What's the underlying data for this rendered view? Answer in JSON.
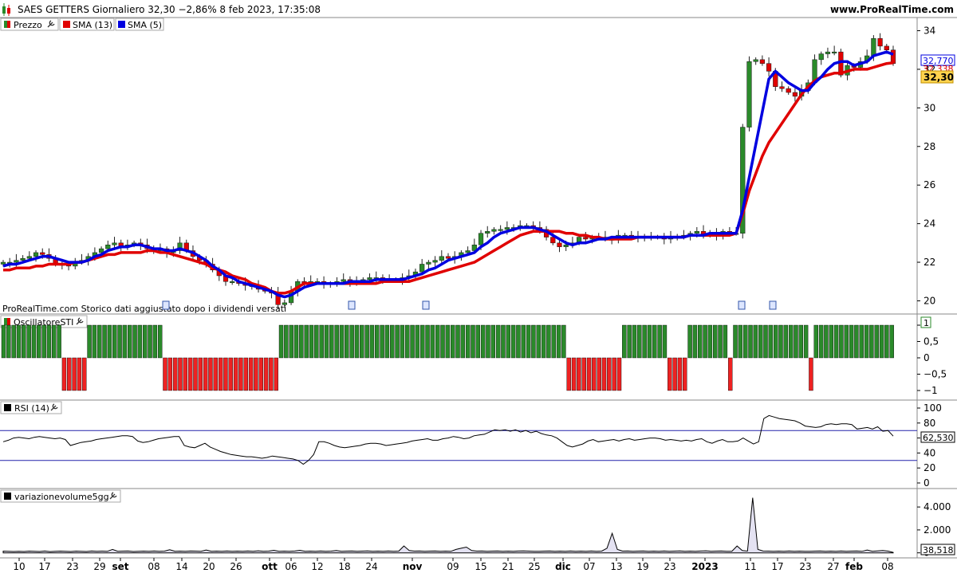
{
  "header": {
    "title": "SAES GETTERS Giornaliero 32,30 −2,86% 8 feb 2023, 17:35:08",
    "site": "www.ProRealTime.com"
  },
  "panels": {
    "price": {
      "legend": [
        {
          "label": "Prezzo",
          "color": "#2a8a2a"
        },
        {
          "label": "SMA (13)",
          "color": "#e00000"
        },
        {
          "label": "SMA (5)",
          "color": "#0000e0"
        }
      ],
      "note": "ProRealTime.com  Storico dati aggiustato dopo i dividendi versati",
      "sma5_badge": "32,770",
      "sma13_badge": "32,338",
      "price_badge": "32,30"
    },
    "osc": {
      "legend": "OscillatoreSTI",
      "badge": "1"
    },
    "rsi": {
      "legend": "RSI (14)",
      "badge": "62,530"
    },
    "vol": {
      "legend": "variazionevolume5gg",
      "badge": "38,518"
    }
  },
  "chart_data": [
    {
      "type": "candlestick",
      "panel": "price",
      "y_ticks": [
        "34",
        "32",
        "30",
        "28",
        "26",
        "24",
        "22",
        "20"
      ],
      "ylim": [
        19.4,
        34.6
      ],
      "x_labels": [
        "10",
        "17",
        "23",
        "29",
        "set",
        "08",
        "14",
        "20",
        "26",
        "ott",
        "06",
        "12",
        "18",
        "24",
        "nov",
        "09",
        "15",
        "21",
        "25",
        "dic",
        "07",
        "13",
        "19",
        "23",
        "2023",
        "11",
        "17",
        "23",
        "27",
        "feb",
        "08"
      ],
      "x_label_bold": [
        "set",
        "ott",
        "nov",
        "dic",
        "2023",
        "feb"
      ],
      "series": [
        {
          "name": "Prezzo",
          "values": [
            22.0,
            22.0,
            22.1,
            22.2,
            22.3,
            22.5,
            22.4,
            22.2,
            21.9,
            21.9,
            21.8,
            22.0,
            22.1,
            22.3,
            22.5,
            22.7,
            22.9,
            23.0,
            22.8,
            22.9,
            23.0,
            22.9,
            22.7,
            22.6,
            22.7,
            22.5,
            22.6,
            23.0,
            22.6,
            22.3,
            22.1,
            21.9,
            21.6,
            21.3,
            21.0,
            21.0,
            20.9,
            20.8,
            20.8,
            20.6,
            20.5,
            20.4,
            19.8,
            19.9,
            20.5,
            21.0,
            20.9,
            21.0,
            21.0,
            20.9,
            20.9,
            21.0,
            21.1,
            21.0,
            21.0,
            21.1,
            21.2,
            21.2,
            21.1,
            21.1,
            21.1,
            21.2,
            21.3,
            21.5,
            21.9,
            22.0,
            22.1,
            22.3,
            22.2,
            22.3,
            22.5,
            22.6,
            22.9,
            23.5,
            23.6,
            23.7,
            23.7,
            23.8,
            23.8,
            23.9,
            23.9,
            23.8,
            23.7,
            23.3,
            23.0,
            22.8,
            22.9,
            23.0,
            23.3,
            23.2,
            23.3,
            23.3,
            23.2,
            23.2,
            23.4,
            23.4,
            23.3,
            23.3,
            23.3,
            23.3,
            23.3,
            23.2,
            23.3,
            23.3,
            23.4,
            23.5,
            23.6,
            23.4,
            23.5,
            23.4,
            23.6,
            23.5,
            23.5,
            29.0,
            32.4,
            32.5,
            32.3,
            31.9,
            31.1,
            31.0,
            30.8,
            30.6,
            30.9,
            31.3,
            32.5,
            32.8,
            32.9,
            32.9,
            31.7,
            32.2,
            32.1,
            32.4,
            32.7,
            33.6,
            33.2,
            33.0,
            32.3
          ]
        },
        {
          "name": "SMA (13)",
          "values": [
            21.6,
            21.6,
            21.7,
            21.7,
            21.7,
            21.8,
            21.8,
            21.9,
            21.9,
            21.9,
            21.9,
            22.0,
            22.0,
            22.1,
            22.2,
            22.3,
            22.4,
            22.4,
            22.5,
            22.5,
            22.5,
            22.5,
            22.6,
            22.6,
            22.5,
            22.5,
            22.4,
            22.3,
            22.2,
            22.1,
            22.0,
            21.9,
            21.7,
            21.6,
            21.5,
            21.3,
            21.2,
            21.1,
            20.9,
            20.8,
            20.7,
            20.5,
            20.4,
            20.4,
            20.5,
            20.7,
            20.9,
            20.9,
            20.9,
            20.9,
            20.9,
            20.9,
            20.9,
            20.9,
            20.9,
            20.9,
            20.9,
            20.9,
            21.0,
            21.0,
            21.0,
            21.0,
            21.0,
            21.1,
            21.2,
            21.3,
            21.4,
            21.5,
            21.6,
            21.7,
            21.8,
            21.9,
            22.0,
            22.2,
            22.4,
            22.6,
            22.8,
            23.0,
            23.2,
            23.4,
            23.5,
            23.6,
            23.6,
            23.6,
            23.6,
            23.6,
            23.5,
            23.5,
            23.4,
            23.4,
            23.3,
            23.3,
            23.2,
            23.2,
            23.2,
            23.2,
            23.2,
            23.3,
            23.3,
            23.3,
            23.3,
            23.3,
            23.3,
            23.3,
            23.3,
            23.4,
            23.4,
            23.4,
            23.4,
            23.4,
            23.4,
            23.4,
            23.5,
            24.5,
            25.7,
            26.6,
            27.5,
            28.2,
            28.7,
            29.2,
            29.7,
            30.2,
            30.7,
            31.1,
            31.4,
            31.6,
            31.7,
            31.8,
            31.8,
            31.9,
            32.0,
            32.0,
            32.0,
            32.1,
            32.2,
            32.3,
            32.338
          ]
        },
        {
          "name": "SMA (5)",
          "values": [
            21.8,
            21.9,
            21.9,
            22.0,
            22.1,
            22.2,
            22.3,
            22.3,
            22.2,
            22.1,
            22.0,
            22.0,
            22.0,
            22.1,
            22.3,
            22.4,
            22.6,
            22.7,
            22.8,
            22.8,
            22.9,
            22.9,
            22.8,
            22.7,
            22.7,
            22.6,
            22.6,
            22.7,
            22.6,
            22.5,
            22.3,
            22.1,
            21.8,
            21.6,
            21.3,
            21.2,
            21.0,
            20.9,
            20.8,
            20.7,
            20.6,
            20.5,
            20.3,
            20.2,
            20.3,
            20.5,
            20.7,
            20.8,
            20.9,
            20.9,
            20.9,
            20.9,
            20.9,
            21.0,
            21.0,
            21.0,
            21.0,
            21.1,
            21.1,
            21.1,
            21.1,
            21.1,
            21.2,
            21.3,
            21.4,
            21.6,
            21.7,
            21.9,
            22.1,
            22.2,
            22.3,
            22.4,
            22.5,
            22.8,
            23.0,
            23.3,
            23.5,
            23.6,
            23.7,
            23.8,
            23.8,
            23.8,
            23.7,
            23.6,
            23.4,
            23.2,
            23.0,
            22.9,
            23.0,
            23.0,
            23.1,
            23.2,
            23.2,
            23.3,
            23.3,
            23.3,
            23.3,
            23.3,
            23.3,
            23.3,
            23.3,
            23.3,
            23.3,
            23.3,
            23.3,
            23.4,
            23.4,
            23.4,
            23.5,
            23.5,
            23.5,
            23.5,
            23.5,
            24.7,
            26.4,
            28.1,
            29.8,
            31.5,
            31.9,
            31.6,
            31.3,
            31.1,
            30.9,
            30.9,
            31.3,
            31.6,
            32.0,
            32.3,
            32.4,
            32.4,
            32.2,
            32.3,
            32.4,
            32.7,
            32.8,
            32.9,
            32.77
          ]
        }
      ]
    },
    {
      "type": "bar",
      "panel": "osc",
      "y_ticks": [
        "1",
        "0,5",
        "0",
        "−0,5",
        "−1"
      ],
      "ylim": [
        -1.12,
        1.12
      ],
      "series": [
        {
          "name": "OscillatoreSTI",
          "values": [
            1,
            1,
            1,
            1,
            1,
            1,
            1,
            1,
            1,
            1,
            1,
            1,
            -1,
            -1,
            -1,
            -1,
            -1,
            1,
            1,
            1,
            1,
            1,
            1,
            1,
            1,
            1,
            1,
            1,
            1,
            1,
            1,
            1,
            -1,
            -1,
            -1,
            -1,
            -1,
            -1,
            -1,
            -1,
            -1,
            -1,
            -1,
            -1,
            -1,
            -1,
            -1,
            -1,
            -1,
            -1,
            -1,
            -1,
            -1,
            -1,
            -1,
            1,
            1,
            1,
            1,
            1,
            1,
            1,
            1,
            1,
            1,
            1,
            1,
            1,
            1,
            1,
            1,
            1,
            1,
            1,
            1,
            1,
            1,
            1,
            1,
            1,
            1,
            1,
            1,
            1,
            1,
            1,
            1,
            1,
            1,
            1,
            1,
            1,
            1,
            1,
            1,
            1,
            1,
            1,
            1,
            1,
            1,
            1,
            1,
            1,
            1,
            1,
            1,
            1,
            1,
            1,
            1,
            1,
            -1,
            -1,
            -1,
            -1,
            -1,
            -1,
            -1,
            -1,
            -1,
            -1,
            -1,
            1,
            1,
            1,
            1,
            1,
            1,
            1,
            1,
            1,
            -1,
            -1,
            -1,
            -1,
            1,
            1,
            1,
            1,
            1,
            1,
            1,
            1,
            -1,
            1,
            1,
            1,
            1,
            1,
            1,
            1,
            1,
            1,
            1,
            1,
            1,
            1,
            1,
            1,
            -1,
            1,
            1,
            1,
            1,
            1,
            1,
            1,
            1,
            1,
            1,
            1,
            1,
            1,
            1,
            1,
            1
          ]
        }
      ]
    },
    {
      "type": "line",
      "panel": "rsi",
      "y_ticks": [
        "100",
        "80",
        "60",
        "40",
        "20",
        "0"
      ],
      "ylim": [
        0,
        100
      ],
      "ref_lines": [
        70,
        30
      ],
      "series": [
        {
          "name": "RSI (14)",
          "values": [
            55,
            57,
            60,
            61,
            60,
            59,
            61,
            62,
            61,
            60,
            59,
            60,
            58,
            50,
            52,
            54,
            55,
            56,
            58,
            59,
            60,
            61,
            62,
            63,
            63,
            62,
            56,
            54,
            55,
            57,
            59,
            60,
            61,
            62,
            62,
            50,
            48,
            47,
            50,
            53,
            48,
            45,
            42,
            40,
            38,
            37,
            36,
            35,
            35,
            34,
            33,
            34,
            36,
            35,
            34,
            33,
            32,
            30,
            25,
            30,
            38,
            55,
            55,
            53,
            50,
            48,
            47,
            48,
            49,
            50,
            52,
            53,
            53,
            52,
            50,
            51,
            52,
            53,
            54,
            56,
            57,
            58,
            59,
            57,
            57,
            59,
            60,
            62,
            61,
            59,
            60,
            63,
            64,
            65,
            68,
            71,
            70,
            71,
            69,
            71,
            68,
            70,
            67,
            69,
            66,
            64,
            63,
            60,
            55,
            50,
            48,
            50,
            52,
            56,
            58,
            55,
            56,
            57,
            58,
            56,
            58,
            59,
            57,
            58,
            59,
            60,
            60,
            59,
            57,
            58,
            57,
            56,
            57,
            56,
            58,
            59,
            55,
            53,
            56,
            58,
            55,
            55,
            56,
            60,
            56,
            52,
            55,
            86,
            90,
            88,
            86,
            85,
            84,
            83,
            80,
            76,
            75,
            74,
            75,
            78,
            79,
            78,
            79,
            79,
            78,
            72,
            73,
            74,
            72,
            75,
            69,
            70,
            62.53
          ]
        }
      ]
    },
    {
      "type": "area",
      "panel": "vol",
      "y_ticks": [
        "4.000",
        "2.000",
        "0"
      ],
      "ylim": [
        -300,
        5400
      ],
      "series": [
        {
          "name": "variazionevolume5gg",
          "values": [
            150,
            130,
            120,
            140,
            120,
            150,
            130,
            120,
            160,
            110,
            130,
            150,
            140,
            120,
            150,
            130,
            120,
            160,
            140,
            150,
            130,
            300,
            140,
            150,
            160,
            120,
            140,
            150,
            130,
            160,
            140,
            150,
            270,
            140,
            150,
            130,
            160,
            150,
            140,
            250,
            140,
            150,
            130,
            160,
            140,
            150,
            130,
            160,
            140,
            180,
            130,
            150,
            220,
            140,
            150,
            130,
            160,
            220,
            140,
            150,
            130,
            160,
            140,
            150,
            200,
            140,
            150,
            160,
            130,
            150,
            170,
            140,
            150,
            130,
            160,
            140,
            150,
            600,
            200,
            150,
            160,
            130,
            150,
            160,
            140,
            150,
            130,
            300,
            400,
            500,
            200,
            150,
            160,
            130,
            150,
            160,
            140,
            150,
            130,
            160,
            170,
            150,
            140,
            130,
            150,
            160,
            140,
            150,
            130,
            160,
            140,
            150,
            130,
            160,
            140,
            150,
            400,
            1700,
            300,
            150,
            160,
            130,
            150,
            160,
            140,
            150,
            130,
            160,
            140,
            150,
            170,
            140,
            150,
            130,
            160,
            180,
            140,
            150,
            160,
            130,
            140,
            600,
            200,
            150,
            4800,
            300,
            160,
            150,
            140,
            150,
            130,
            160,
            140,
            150,
            130,
            140,
            150,
            160,
            140,
            150,
            130,
            160,
            140,
            150,
            160,
            130,
            250,
            140,
            170,
            200,
            150,
            38.518
          ]
        }
      ]
    }
  ]
}
